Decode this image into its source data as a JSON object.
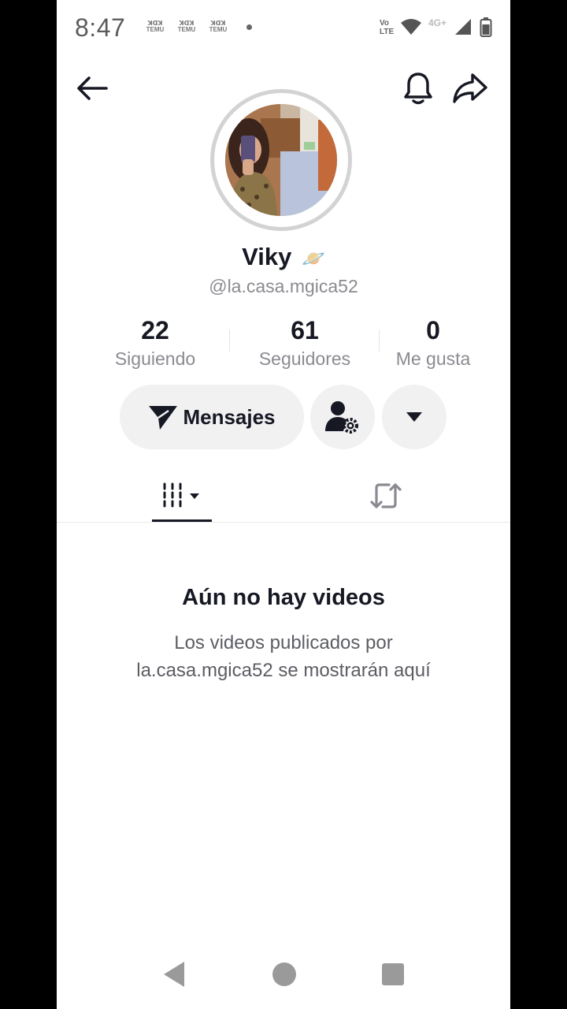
{
  "status_bar": {
    "time": "8:47",
    "notifications": [
      "TEMU",
      "TEMU",
      "TEMU"
    ],
    "volte": "Vo LTE",
    "network": "4G+"
  },
  "profile": {
    "name": "Viky",
    "name_emoji": "🪐",
    "handle": "@la.casa.mgica52"
  },
  "stats": [
    {
      "value": "22",
      "label": "Siguiendo"
    },
    {
      "value": "61",
      "label": "Seguidores"
    },
    {
      "value": "0",
      "label": "Me gusta"
    }
  ],
  "actions": {
    "message_label": "Mensajes"
  },
  "empty_state": {
    "title": "Aún no hay videos",
    "description": "Los videos publicados por la.casa.mgica52 se mostrarán aquí"
  },
  "icons": {
    "back": "arrow-left-icon",
    "bell": "bell-icon",
    "share": "share-icon",
    "message": "send-icon",
    "user_settings": "user-gear-icon",
    "more": "caret-down-icon",
    "videos_tab": "grid-icon",
    "reposts_tab": "repost-icon"
  }
}
